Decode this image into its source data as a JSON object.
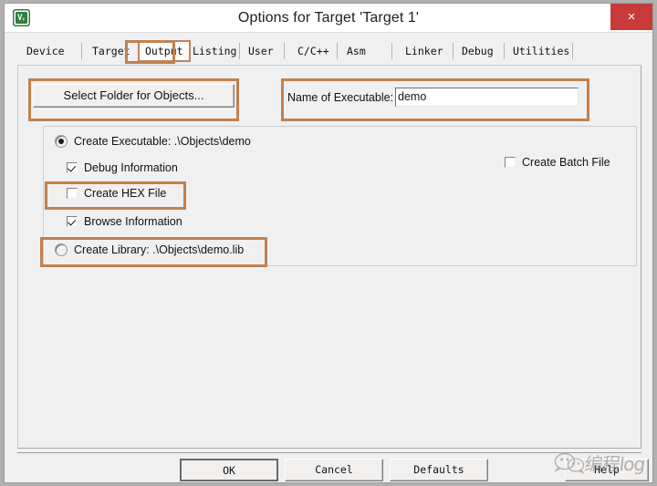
{
  "window": {
    "title": "Options for Target 'Target 1'",
    "app_icon": "keil-uvision-icon",
    "close_label": "×",
    "accent_highlight": "#c0814f",
    "close_button_color": "#c93b3b"
  },
  "tabs": [
    {
      "label": "Device",
      "selected": false
    },
    {
      "label": "Target",
      "selected": false
    },
    {
      "label": "Output",
      "selected": true
    },
    {
      "label": "Listing",
      "selected": false
    },
    {
      "label": "User",
      "selected": false
    },
    {
      "label": "C/C++",
      "selected": false
    },
    {
      "label": "Asm",
      "selected": false
    },
    {
      "label": "Linker",
      "selected": false
    },
    {
      "label": "Debug",
      "selected": false
    },
    {
      "label": "Utilities",
      "selected": false
    }
  ],
  "output_tab": {
    "select_folder_button": "Select Folder for Objects...",
    "executable_label": "Name of Executable:",
    "executable_value": "demo",
    "executable_placeholder": "",
    "options": {
      "create_executable": {
        "label": "Create Executable:  .\\Objects\\demo",
        "checked": true,
        "type": "radio"
      },
      "debug_information": {
        "label": "Debug Information",
        "checked": true,
        "type": "checkbox"
      },
      "create_hex_file": {
        "label": "Create HEX File",
        "checked": false,
        "type": "checkbox"
      },
      "browse_information": {
        "label": "Browse Information",
        "checked": true,
        "type": "checkbox"
      },
      "create_library": {
        "label": "Create Library:  .\\Objects\\demo.lib",
        "checked": false,
        "type": "radio"
      },
      "create_batch_file": {
        "label": "Create Batch File",
        "checked": false,
        "type": "checkbox"
      }
    }
  },
  "footer": {
    "ok": "OK",
    "cancel": "Cancel",
    "defaults": "Defaults",
    "help": "Help"
  },
  "watermark": {
    "text": "编程log",
    "icon": "wechat-icon"
  }
}
